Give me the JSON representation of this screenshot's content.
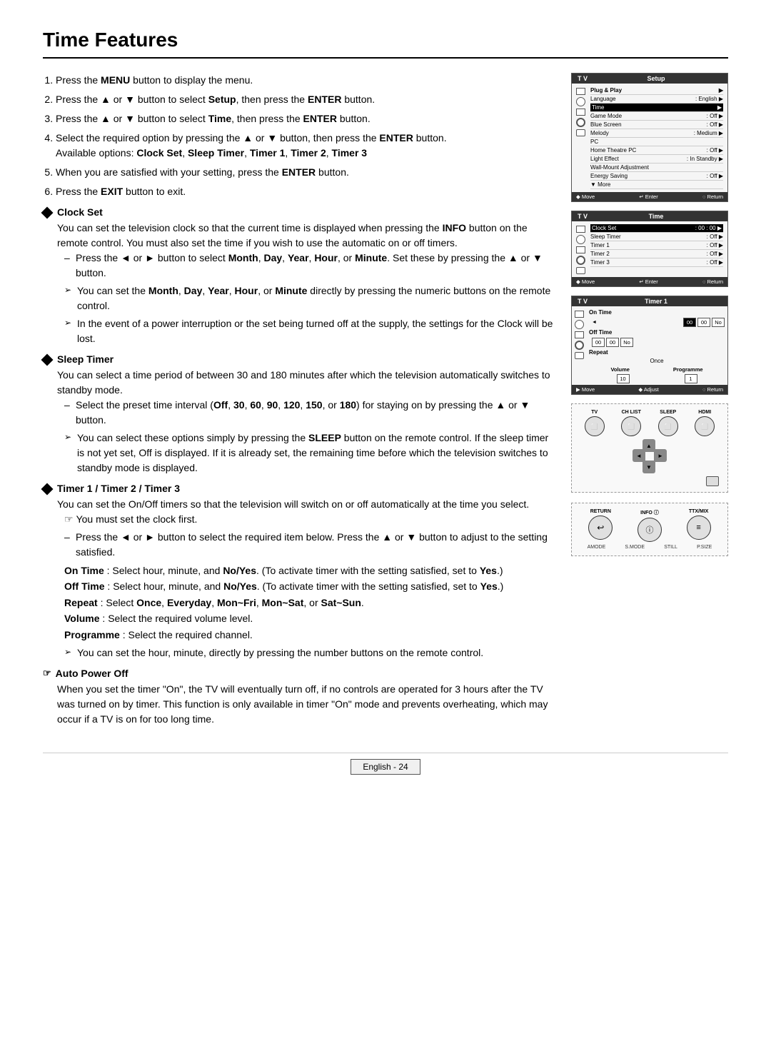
{
  "page": {
    "title": "Time Features",
    "footer": "English - 24"
  },
  "steps": [
    {
      "num": "1",
      "text": "Press the ",
      "bold": "MENU",
      "rest": " button to display the menu."
    },
    {
      "num": "2",
      "text": "Press the ▲ or ▼ button to select ",
      "bold": "Setup",
      "rest": ", then press the ",
      "bold2": "ENTER",
      "rest2": " button."
    },
    {
      "num": "3",
      "text": "Press the ▲ or ▼ button to select ",
      "bold": "Time",
      "rest": ", then press the ",
      "bold2": "ENTER",
      "rest2": " button."
    }
  ],
  "sections": {
    "clock_set_header": "Clock Set",
    "sleep_timer_header": "Sleep Timer",
    "timer_header": "Timer 1 / Timer 2 / Timer 3",
    "auto_power_header": "Auto Power Off"
  },
  "tv_setup": {
    "header": "Setup",
    "items": [
      {
        "label": "Plug & Play",
        "value": ""
      },
      {
        "label": "Language",
        "value": ": English"
      },
      {
        "label": "Time",
        "value": ""
      },
      {
        "label": "Game Mode",
        "value": ": Off"
      },
      {
        "label": "Blue Screen",
        "value": ": Off"
      },
      {
        "label": "Melody",
        "value": ": Medium"
      },
      {
        "label": "PC",
        "value": ""
      },
      {
        "label": "Home Theatre PC",
        "value": ": Off"
      },
      {
        "label": "Light Effect",
        "value": ": In Standby"
      },
      {
        "label": "Wall-Mount Adjustment",
        "value": ""
      },
      {
        "label": "Energy Saving",
        "value": ": Off"
      },
      {
        "label": "▼ More",
        "value": ""
      }
    ],
    "footer_move": "◆ Move",
    "footer_enter": "↵ Enter",
    "footer_return": "◌ Return"
  },
  "tv_time": {
    "header": "Time",
    "items": [
      {
        "label": "Clock Set",
        "value": ": 00 : 00"
      },
      {
        "label": "Sleep Timer",
        "value": ": Off"
      },
      {
        "label": "Timer 1",
        "value": ": Off"
      },
      {
        "label": "Timer 2",
        "value": ": Off"
      },
      {
        "label": "Timer 3",
        "value": ": Off"
      }
    ],
    "footer_move": "◆ Move",
    "footer_enter": "↵ Enter",
    "footer_return": "◌ Return"
  },
  "tv_timer": {
    "header": "Timer 1",
    "on_time_label": "On Time",
    "on_hour": "00",
    "on_min": "00",
    "on_no": "No",
    "off_time_label": "Off Time",
    "off_hour": "00",
    "off_min": "00",
    "off_no": "No",
    "repeat_label": "Repeat",
    "repeat_value": "Once",
    "volume_label": "Volume",
    "programme_label": "Programme",
    "volume_value": "10",
    "programme_value": "1",
    "footer_move": "▶ Move",
    "footer_adjust": "◆ Adjust",
    "footer_return": "◌ Return"
  },
  "remote1": {
    "buttons": [
      {
        "label": "TV",
        "shape": "circle"
      },
      {
        "label": "CH LIST",
        "shape": "circle"
      },
      {
        "label": "SLEEP",
        "shape": "circle"
      },
      {
        "label": "HDMI",
        "shape": "circle"
      }
    ]
  },
  "remote2": {
    "buttons": [
      {
        "label": "RETURN",
        "shape": "circle"
      },
      {
        "label": "INFO ⓘ",
        "shape": "circle"
      },
      {
        "label": "TTX/MIX",
        "shape": "circle"
      }
    ],
    "sub_labels": [
      "AMODE",
      "S.MODE",
      "STILL",
      "P.SIZE"
    ]
  }
}
